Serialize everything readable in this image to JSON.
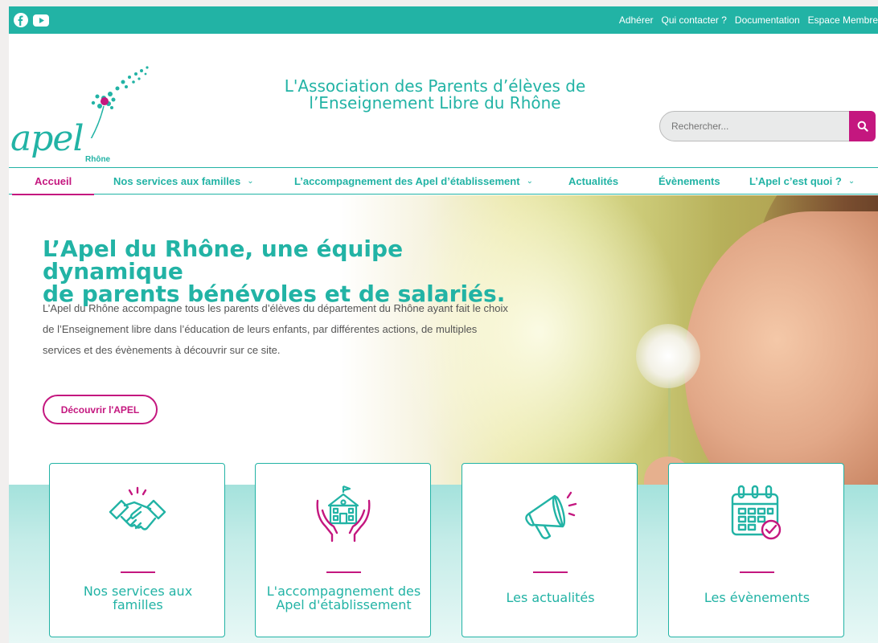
{
  "colors": {
    "teal": "#22b3a5",
    "magenta": "#c4177f"
  },
  "social": [
    {
      "icon": "facebook-icon"
    },
    {
      "icon": "youtube-icon"
    }
  ],
  "toplinks": [
    "Adhérer",
    "Qui contacter ?",
    "Documentation",
    "Espace Membre"
  ],
  "logo": {
    "text": "apel",
    "sub": "Rhône"
  },
  "site_title": {
    "line1": "L'Association des Parents d’élèves de",
    "line2": "l’Enseignement Libre du Rhône"
  },
  "search": {
    "placeholder": "Rechercher..."
  },
  "nav": [
    {
      "label": "Accueil",
      "active": true
    },
    {
      "label": "Nos services aux familles",
      "dropdown": true
    },
    {
      "label": "L’accompagnement des Apel d’établissement",
      "dropdown": true
    },
    {
      "label": "Actualités"
    },
    {
      "label": "Évènements"
    },
    {
      "label": "L’Apel c’est quoi ?",
      "dropdown": true
    }
  ],
  "hero": {
    "title_line1": "L’Apel du Rhône, une équipe dynamique",
    "title_line2": "de parents bénévoles et de salariés.",
    "text": "L’Apel du Rhône accompagne tous les parents d’élèves du département du Rhône ayant fait le choix de l’Enseignement libre dans l’éducation de leurs enfants, par différentes actions, de multiples services et des évènements à découvrir sur ce site.",
    "button": "Découvrir l'APEL"
  },
  "cards": [
    {
      "icon": "handshake-icon",
      "label": "Nos services aux familles"
    },
    {
      "icon": "school-hands-icon",
      "label": "L'accompagnement des Apel d'établissement"
    },
    {
      "icon": "megaphone-icon",
      "label": "Les actualités"
    },
    {
      "icon": "calendar-icon",
      "label": "Les évènements"
    }
  ]
}
